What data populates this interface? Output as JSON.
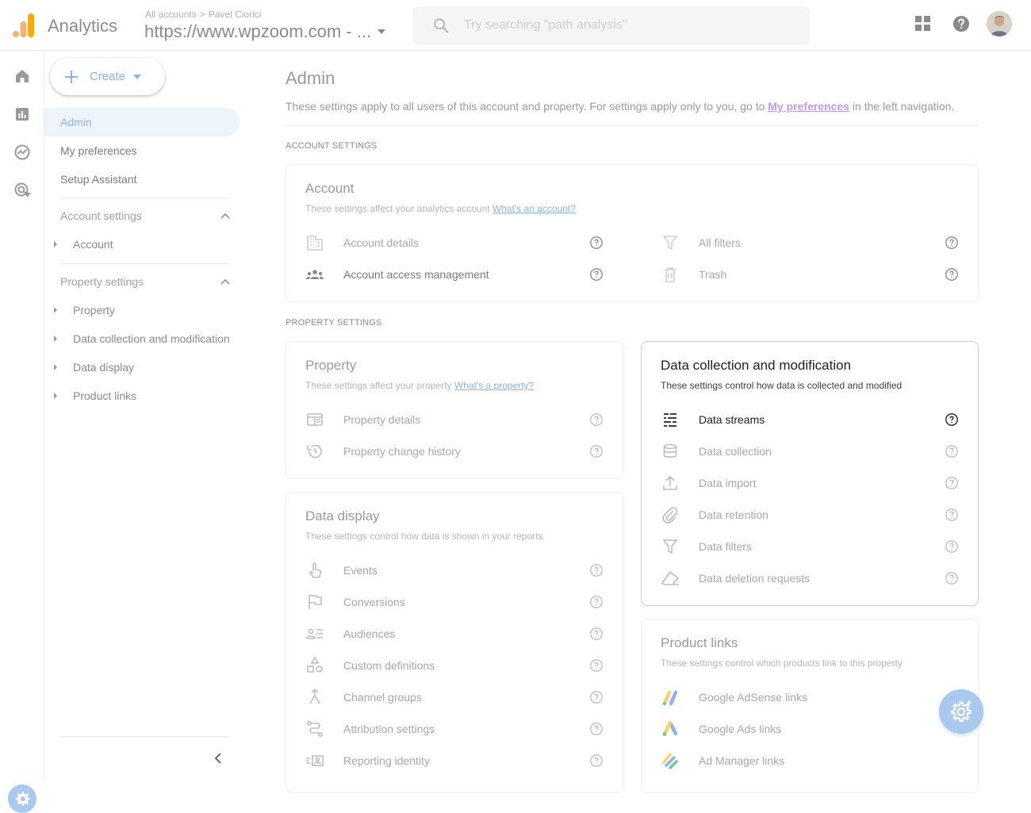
{
  "header": {
    "app_name": "Analytics",
    "breadcrumb_account": "All accounts",
    "breadcrumb_separator": ">",
    "breadcrumb_user": "Pavel Ciorici",
    "property_name": "https://www.wpzoom.com - ...",
    "search_placeholder": "Try searching \"path analysis\"",
    "icons": [
      "apps-grid-icon",
      "help-icon",
      "avatar"
    ]
  },
  "rail": {
    "icons": [
      "home-icon",
      "reports-icon",
      "explore-icon",
      "advertising-icon",
      "admin-gear-icon"
    ]
  },
  "nav": {
    "create_label": "Create",
    "items": [
      {
        "label": "Admin",
        "active": true
      },
      {
        "label": "My preferences"
      },
      {
        "label": "Setup Assistant"
      }
    ],
    "account_section": {
      "title": "Account settings",
      "children": [
        "Account"
      ]
    },
    "property_section": {
      "title": "Property settings",
      "children": [
        "Property",
        "Data collection and modification",
        "Data display",
        "Product links"
      ]
    }
  },
  "main": {
    "title": "Admin",
    "description_prefix": "These settings apply to all users of this account and property. For settings apply only to you, go to ",
    "description_link": "My preferences",
    "description_suffix": " in the left navigation.",
    "account_section_label": "ACCOUNT SETTINGS",
    "property_section_label": "PROPERTY SETTINGS",
    "account_card": {
      "title": "Account",
      "subtitle": "These settings affect your analytics account",
      "subtitle_link": "What's an account?",
      "left_items": [
        {
          "label": "Account details",
          "icon": "building-icon"
        },
        {
          "label": "Account access management",
          "icon": "people-icon"
        }
      ],
      "right_items": [
        {
          "label": "All filters",
          "icon": "filter-icon"
        },
        {
          "label": "Trash",
          "icon": "trash-icon"
        }
      ]
    },
    "property_card": {
      "title": "Property",
      "subtitle": "These settings affect your property",
      "subtitle_link": "What's a property?",
      "items": [
        {
          "label": "Property details",
          "icon": "property-card-icon"
        },
        {
          "label": "Property change history",
          "icon": "history-icon"
        }
      ]
    },
    "data_collection_card": {
      "title": "Data collection and modification",
      "subtitle": "These settings control how data is collected and modified",
      "items": [
        {
          "label": "Data streams",
          "icon": "data-streams-icon"
        },
        {
          "label": "Data collection",
          "icon": "database-icon"
        },
        {
          "label": "Data import",
          "icon": "upload-icon"
        },
        {
          "label": "Data retention",
          "icon": "paperclip-icon"
        },
        {
          "label": "Data filters",
          "icon": "filter-icon"
        },
        {
          "label": "Data deletion requests",
          "icon": "eraser-icon"
        }
      ]
    },
    "data_display_card": {
      "title": "Data display",
      "subtitle": "These settings control how data is shown in your reports",
      "items": [
        {
          "label": "Events",
          "icon": "touch-icon"
        },
        {
          "label": "Conversions",
          "icon": "flag-icon"
        },
        {
          "label": "Audiences",
          "icon": "audience-icon"
        },
        {
          "label": "Custom definitions",
          "icon": "shapes-icon"
        },
        {
          "label": "Channel groups",
          "icon": "merge-icon"
        },
        {
          "label": "Attribution settings",
          "icon": "attribution-icon"
        },
        {
          "label": "Reporting identity",
          "icon": "identity-icon"
        }
      ]
    },
    "product_links_card": {
      "title": "Product links",
      "subtitle": "These settings control which products link to this property",
      "items": [
        {
          "label": "Google AdSense links",
          "icon": "adsense-logo"
        },
        {
          "label": "Google Ads links",
          "icon": "google-ads-logo"
        },
        {
          "label": "Ad Manager links",
          "icon": "ad-manager-logo"
        }
      ]
    }
  },
  "colors": {
    "accent": "#1a73e8",
    "logo_orange": "#f9ab00",
    "logo_dark_orange": "#e37400"
  }
}
